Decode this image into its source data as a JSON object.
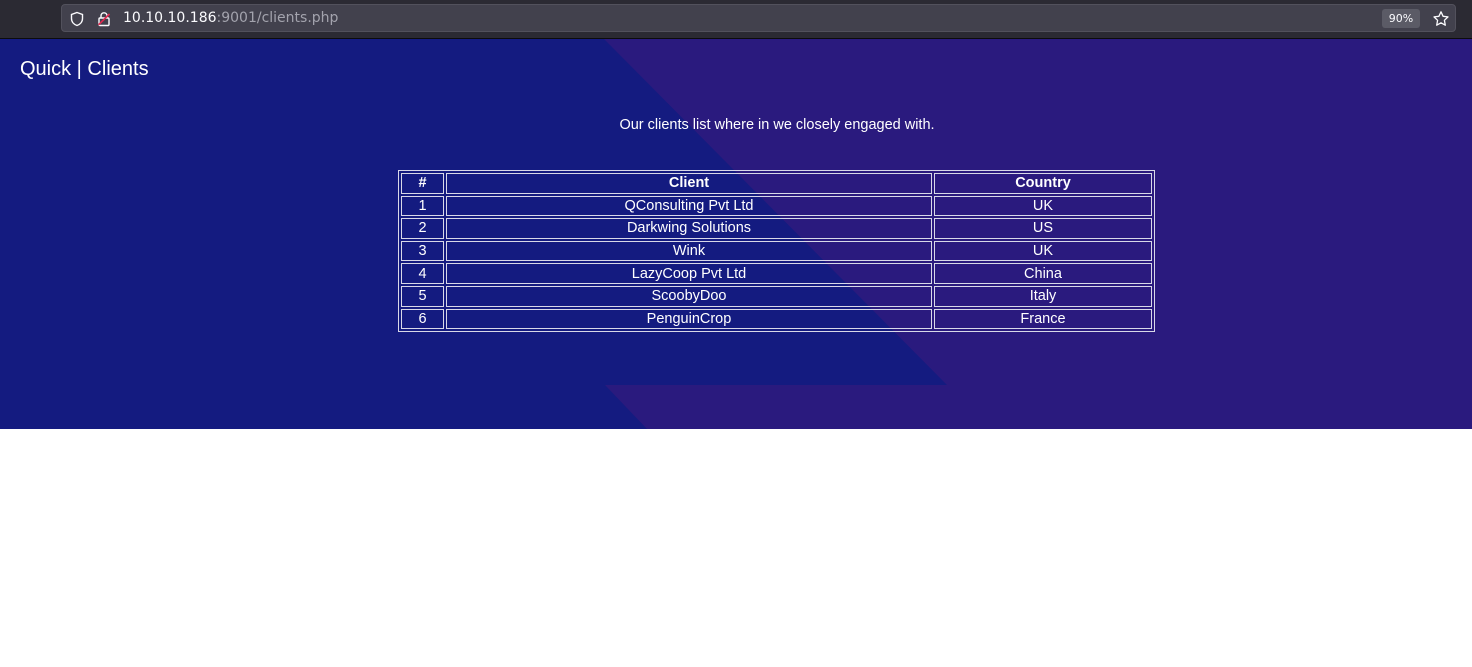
{
  "browser": {
    "url_host": "10.10.10.186",
    "url_path": ":9001/clients.php",
    "zoom": "90%",
    "icons": [
      "shield-icon",
      "lock-insecure-icon",
      "bookmark-star-icon"
    ]
  },
  "page": {
    "brand": "Quick | Clients",
    "intro": "Our clients list where in we closely engaged with.",
    "colors": {
      "background": "#141b80",
      "accent_shape": "#2a1a7e",
      "text": "#ffffff"
    }
  },
  "table": {
    "headers": [
      "#",
      "Client",
      "Country"
    ],
    "rows": [
      [
        "1",
        "QConsulting Pvt Ltd",
        "UK"
      ],
      [
        "2",
        "Darkwing Solutions",
        "US"
      ],
      [
        "3",
        "Wink",
        "UK"
      ],
      [
        "4",
        "LazyCoop Pvt Ltd",
        "China"
      ],
      [
        "5",
        "ScoobyDoo",
        "Italy"
      ],
      [
        "6",
        "PenguinCrop",
        "France"
      ]
    ]
  }
}
